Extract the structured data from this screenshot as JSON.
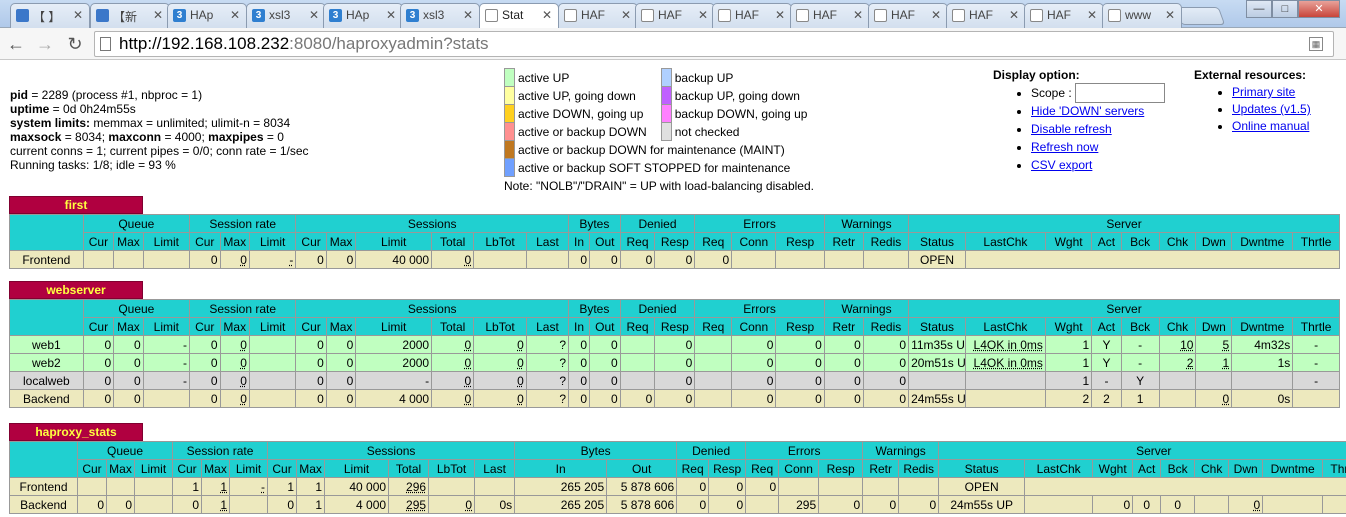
{
  "browser": {
    "tabs": [
      {
        "label": "【 】",
        "icon": "house"
      },
      {
        "label": "【新",
        "icon": "house"
      },
      {
        "label": "HAp",
        "icon": "blue"
      },
      {
        "label": "xsl3",
        "icon": "blue"
      },
      {
        "label": "HAp",
        "icon": "blue"
      },
      {
        "label": "xsl3",
        "icon": "blue"
      },
      {
        "label": "Stat",
        "icon": "page",
        "active": true
      },
      {
        "label": "HAF",
        "icon": "page"
      },
      {
        "label": "HAF",
        "icon": "page"
      },
      {
        "label": "HAF",
        "icon": "page"
      },
      {
        "label": "HAF",
        "icon": "page"
      },
      {
        "label": "HAF",
        "icon": "page"
      },
      {
        "label": "HAF",
        "icon": "page"
      },
      {
        "label": "HAF",
        "icon": "page"
      },
      {
        "label": "www",
        "icon": "page"
      }
    ],
    "url_host": "http://192.168.108.232",
    "url_rest": ":8080/haproxyadmin?stats"
  },
  "info": {
    "pid_label": "pid",
    "pid_value": " = 2289 (process #1, nbproc = 1)",
    "uptime_label": "uptime",
    "uptime_value": " = 0d 0h24m55s",
    "limits_label": "system limits:",
    "limits_value": " memmax = unlimited; ulimit-n = 8034",
    "maxsock_label": "maxsock",
    "maxsock_value": " = 8034; ",
    "maxconn_label": "maxconn",
    "maxconn_value": " = 4000; ",
    "maxpipes_label": "maxpipes",
    "maxpipes_value": " = 0",
    "conns_line": "current conns = 1; current pipes = 0/0; conn rate = 1/sec",
    "tasks_line": "Running tasks: 1/8; idle = 93 %"
  },
  "legend": {
    "items": [
      {
        "color": "#c0ffc0",
        "label": "active UP",
        "color2": "#b0d0ff",
        "label2": "backup UP"
      },
      {
        "color": "#ffffa0",
        "label": "active UP, going down",
        "color2": "#c060ff",
        "label2": "backup UP, going down"
      },
      {
        "color": "#ffd020",
        "label": "active DOWN, going up",
        "color2": "#ff80ff",
        "label2": "backup DOWN, going up"
      },
      {
        "color": "#ff9090",
        "label": "active or backup DOWN",
        "color2": "#e0e0e0",
        "label2": "not checked"
      },
      {
        "color": "#c07820",
        "label": "active or backup DOWN for maintenance (MAINT)"
      },
      {
        "color": "#70a0ff",
        "label": "active or backup SOFT STOPPED for maintenance"
      }
    ],
    "note": "Note: \"NOLB\"/\"DRAIN\" = UP with load-balancing disabled."
  },
  "display": {
    "title": "Display option:",
    "scope_label": "Scope :",
    "links": [
      "Hide 'DOWN' servers",
      "Disable refresh",
      "Refresh now",
      "CSV export"
    ]
  },
  "external": {
    "title": "External resources:",
    "links": [
      "Primary site",
      "Updates (v1.5)",
      "Online manual"
    ]
  },
  "headers": {
    "groups": [
      "Queue",
      "Session rate",
      "Sessions",
      "Bytes",
      "Denied",
      "Errors",
      "Warnings",
      "Server"
    ],
    "cols": [
      "Cur",
      "Max",
      "Limit",
      "Cur",
      "Max",
      "Limit",
      "Cur",
      "Max",
      "Limit",
      "Total",
      "LbTot",
      "Last",
      "In",
      "Out",
      "Req",
      "Resp",
      "Req",
      "Conn",
      "Resp",
      "Retr",
      "Redis",
      "Status",
      "LastChk",
      "Wght",
      "Act",
      "Bck",
      "Chk",
      "Dwn",
      "Dwntme",
      "Thrtle"
    ]
  },
  "proxies": [
    {
      "name": "first",
      "rows": [
        {
          "kind": "frontend",
          "cells": [
            "Frontend",
            "",
            "",
            "",
            "0",
            "0",
            "-",
            "0",
            "0",
            "40 000",
            "0",
            "",
            "",
            "0",
            "0",
            "0",
            "0",
            "0",
            "",
            "",
            "",
            "",
            "OPEN",
            "",
            "",
            "",
            "",
            "",
            "",
            "",
            ""
          ]
        }
      ]
    },
    {
      "name": "webserver",
      "rows": [
        {
          "kind": "active3",
          "cells": [
            "web1",
            "0",
            "0",
            "-",
            "0",
            "0",
            "",
            "0",
            "0",
            "2000",
            "0",
            "0",
            "?",
            "0",
            "0",
            "",
            "0",
            "",
            "0",
            "0",
            "0",
            "0",
            "11m35s UP",
            "L4OK in 0ms",
            "1",
            "Y",
            "-",
            "10",
            "5",
            "4m32s",
            "-"
          ]
        },
        {
          "kind": "active3",
          "cells": [
            "web2",
            "0",
            "0",
            "-",
            "0",
            "0",
            "",
            "0",
            "0",
            "2000",
            "0",
            "0",
            "?",
            "0",
            "0",
            "",
            "0",
            "",
            "0",
            "0",
            "0",
            "0",
            "20m51s UP",
            "L4OK in 0ms",
            "1",
            "Y",
            "-",
            "2",
            "1",
            "1s",
            "-"
          ]
        },
        {
          "kind": "maint",
          "cells": [
            "localweb",
            "0",
            "0",
            "-",
            "0",
            "0",
            "",
            "0",
            "0",
            "-",
            "0",
            "0",
            "?",
            "0",
            "0",
            "",
            "0",
            "",
            "0",
            "0",
            "0",
            "0",
            "",
            "",
            "1",
            "-",
            "Y",
            "",
            "",
            "",
            "-"
          ]
        },
        {
          "kind": "backend",
          "cells": [
            "Backend",
            "0",
            "0",
            "",
            "0",
            "0",
            "",
            "0",
            "0",
            "4 000",
            "0",
            "0",
            "?",
            "0",
            "0",
            "0",
            "0",
            "",
            "0",
            "0",
            "0",
            "0",
            "24m55s UP",
            "",
            "2",
            "2",
            "1",
            "",
            "0",
            "0s",
            ""
          ]
        }
      ]
    },
    {
      "name": "haproxy_stats",
      "rows": [
        {
          "kind": "frontend",
          "cells": [
            "Frontend",
            "",
            "",
            "",
            "1",
            "1",
            "-",
            "1",
            "1",
            "40 000",
            "296",
            "",
            "",
            "265 205",
            "5 878 606",
            "0",
            "0",
            "0",
            "",
            "",
            "",
            "",
            "OPEN",
            "",
            "",
            "",
            "",
            "",
            "",
            "",
            ""
          ]
        },
        {
          "kind": "backend",
          "cells": [
            "Backend",
            "0",
            "0",
            "",
            "0",
            "1",
            "",
            "0",
            "1",
            "4 000",
            "295",
            "0",
            "0s",
            "265 205",
            "5 878 606",
            "0",
            "0",
            "",
            "295",
            "0",
            "0",
            "0",
            "24m55s UP",
            "",
            "0",
            "0",
            "0",
            "",
            "0",
            "",
            ""
          ]
        }
      ]
    }
  ]
}
